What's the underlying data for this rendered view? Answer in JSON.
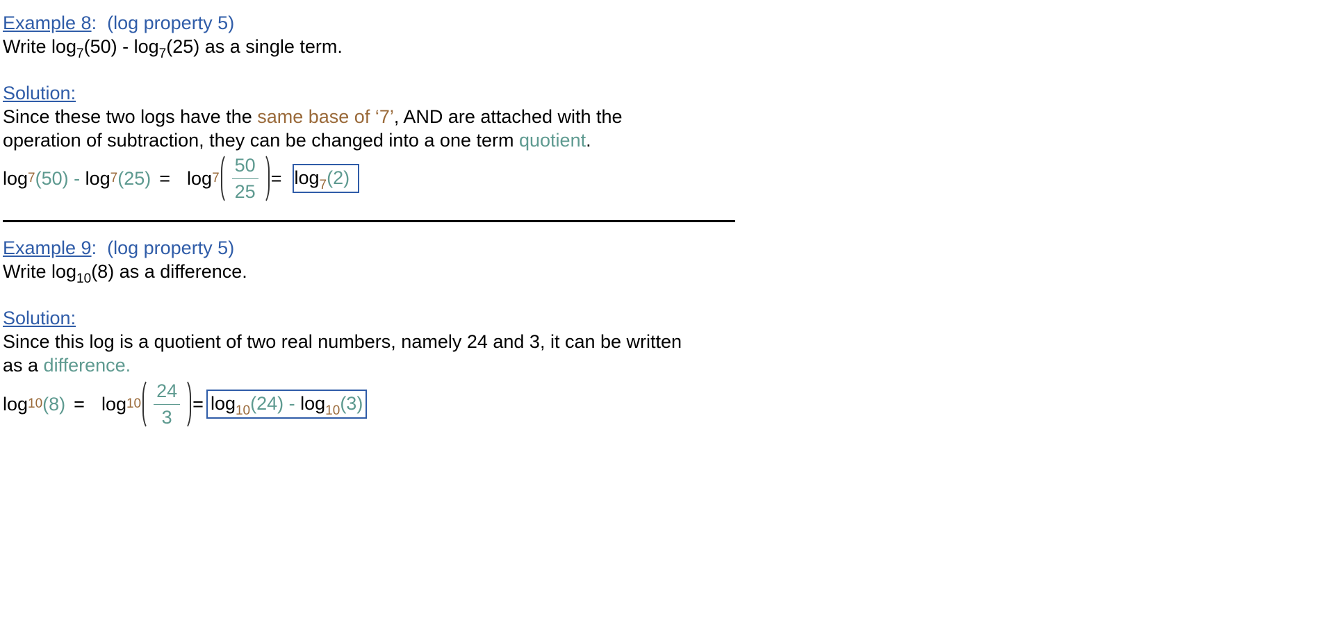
{
  "example8": {
    "heading_label": "Example 8",
    "heading_colon": ":",
    "heading_property": "(log property 5)",
    "prompt_write": "Write log",
    "prompt_base1": "7",
    "prompt_arg1": "(50) - log",
    "prompt_base2": "7",
    "prompt_tail": "(25) as a single term.",
    "solution_label": "Solution:",
    "text_line1_a": "Since these two logs have the ",
    "text_line1_highlight": "same base of ‘7’",
    "text_line1_b": ", AND are attached with the",
    "text_line2_a": "operation of subtraction, they can be changed into a one term ",
    "text_line2_highlight": "quotient",
    "text_line2_b": ".",
    "eq_log1": "log",
    "eq_base1": "7",
    "eq_arg1": "(50)",
    "eq_minus": " - ",
    "eq_log2": "log",
    "eq_base2": "7",
    "eq_arg2": "(25)",
    "eq_equals1": "=",
    "eq_log3": "log",
    "eq_base3": "7",
    "eq_frac_num": "50",
    "eq_frac_den": "25",
    "eq_equals2": "=",
    "ans_log": "log",
    "ans_base": "7",
    "ans_arg": "(2)"
  },
  "example9": {
    "heading_label": "Example 9",
    "heading_colon": ":",
    "heading_property": "(log property 5)",
    "prompt_write": "Write log",
    "prompt_base": "10",
    "prompt_tail": "(8) as a difference.",
    "solution_label": "Solution:",
    "text_line1": "Since this log is a quotient of two real numbers, namely 24 and 3, it can be written",
    "text_line2_a": "as a ",
    "text_line2_highlight": "difference.",
    "eq_log1": "log",
    "eq_base1": "10",
    "eq_arg1": "(8)",
    "eq_equals1": "=",
    "eq_log2": "log",
    "eq_base2": "10",
    "eq_frac_num": "24",
    "eq_frac_den": "3",
    "eq_equals2": "=",
    "ans_log1": "log",
    "ans_base1": "10",
    "ans_arg1": "(24)",
    "ans_minus": " - ",
    "ans_log2": "log",
    "ans_base2": "10",
    "ans_arg2": "(3)"
  },
  "colors": {
    "link_blue": "#2f5ca8",
    "base_brown": "#9a6a3a",
    "value_teal": "#5e9a90"
  }
}
